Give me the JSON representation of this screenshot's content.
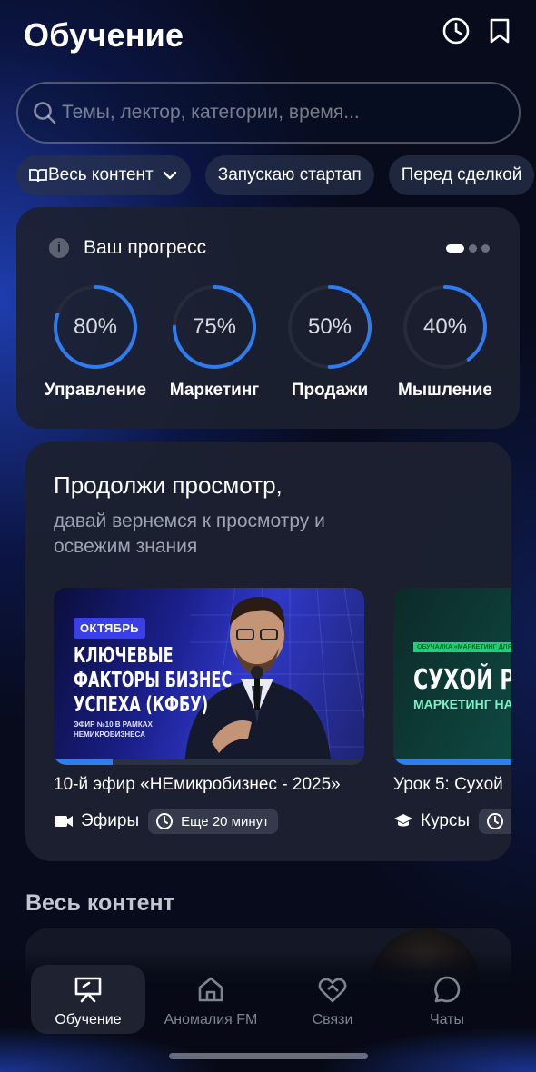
{
  "header": {
    "title": "Обучение",
    "history_icon": "clock-icon",
    "bookmark_icon": "bookmark-icon"
  },
  "search": {
    "placeholder": "Темы, лектор, категории, время..."
  },
  "filters": [
    {
      "label": "Весь контент",
      "icon": "book-open-icon",
      "dropdown": true
    },
    {
      "label": "Запускаю стартап"
    },
    {
      "label": "Перед сделкой"
    }
  ],
  "progress": {
    "title": "Ваш прогресс",
    "info_icon": "i",
    "page_indicator": {
      "pages": 3,
      "current": 1
    },
    "items": [
      {
        "label": "Управление",
        "percent_text": "80%",
        "value": 0.8
      },
      {
        "label": "Маркетинг",
        "percent_text": "75%",
        "value": 0.75
      },
      {
        "label": "Продажи",
        "percent_text": "50%",
        "value": 0.5
      },
      {
        "label": "Мышление",
        "percent_text": "40%",
        "value": 0.4
      }
    ]
  },
  "continue": {
    "title": "Продолжи просмотр,",
    "subtitle": "давай вернемся к просмотру и освежим знания",
    "videos": [
      {
        "thumb_badge": "ОКТЯБРЬ",
        "thumb_title": "КЛЮЧЕВЫЕ ФАКТОРЫ БИЗНЕС УСПЕХА (КФБУ)",
        "thumb_sub": "ЭФИР №10 В РАМКАХ НЕМИКРОБИЗНЕСА",
        "title": "10-й эфир «НЕмикробизнес - 2025»",
        "category": "Эфиры",
        "category_icon": "video-camera-icon",
        "time_left": "Еще 20 минут",
        "watched": 0.19
      },
      {
        "thumb_badge": "ОБУЧАЛКА «МАРКЕТИНГ ДЛЯ ПРЕДПРИЯ",
        "thumb_title": "СУХОЙ РА",
        "thumb_sub": "МАРКЕТИНГ НА ОС",
        "title": "Урок 5: Сухой",
        "category": "Курсы",
        "category_icon": "graduation-cap-icon",
        "watched": 1.0
      }
    ]
  },
  "all_content": {
    "title": "Весь контент"
  },
  "nav": [
    {
      "label": "Обучение",
      "icon": "presentation-board-icon",
      "active": true
    },
    {
      "label": "Аномалия FM",
      "icon": "home-icon",
      "active": false
    },
    {
      "label": "Связи",
      "icon": "handshake-heart-icon",
      "active": false
    },
    {
      "label": "Чаты",
      "icon": "chat-bubble-icon",
      "active": false
    }
  ]
}
